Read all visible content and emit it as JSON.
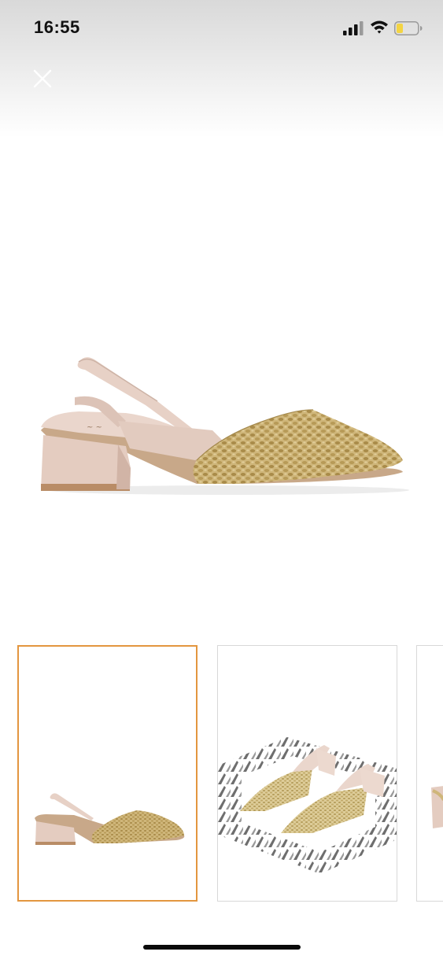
{
  "status_bar": {
    "time": "16:55",
    "signal_icon": "cellular-signal-icon",
    "wifi_icon": "wifi-icon",
    "battery_icon": "battery-low-icon",
    "battery_level": 0.25,
    "battery_color": "#f3d443"
  },
  "header": {
    "close_icon": "close-icon"
  },
  "gallery": {
    "main_image": "slingback-heel-side-view",
    "selected_index": 0,
    "thumbnails": [
      {
        "image": "slingback-heel-side-view",
        "selected": true
      },
      {
        "image": "slingback-pair-on-palm-print",
        "selected": false
      },
      {
        "image": "slingback-heel-partial",
        "selected": false
      }
    ],
    "selected_border_color": "#e3963f"
  }
}
